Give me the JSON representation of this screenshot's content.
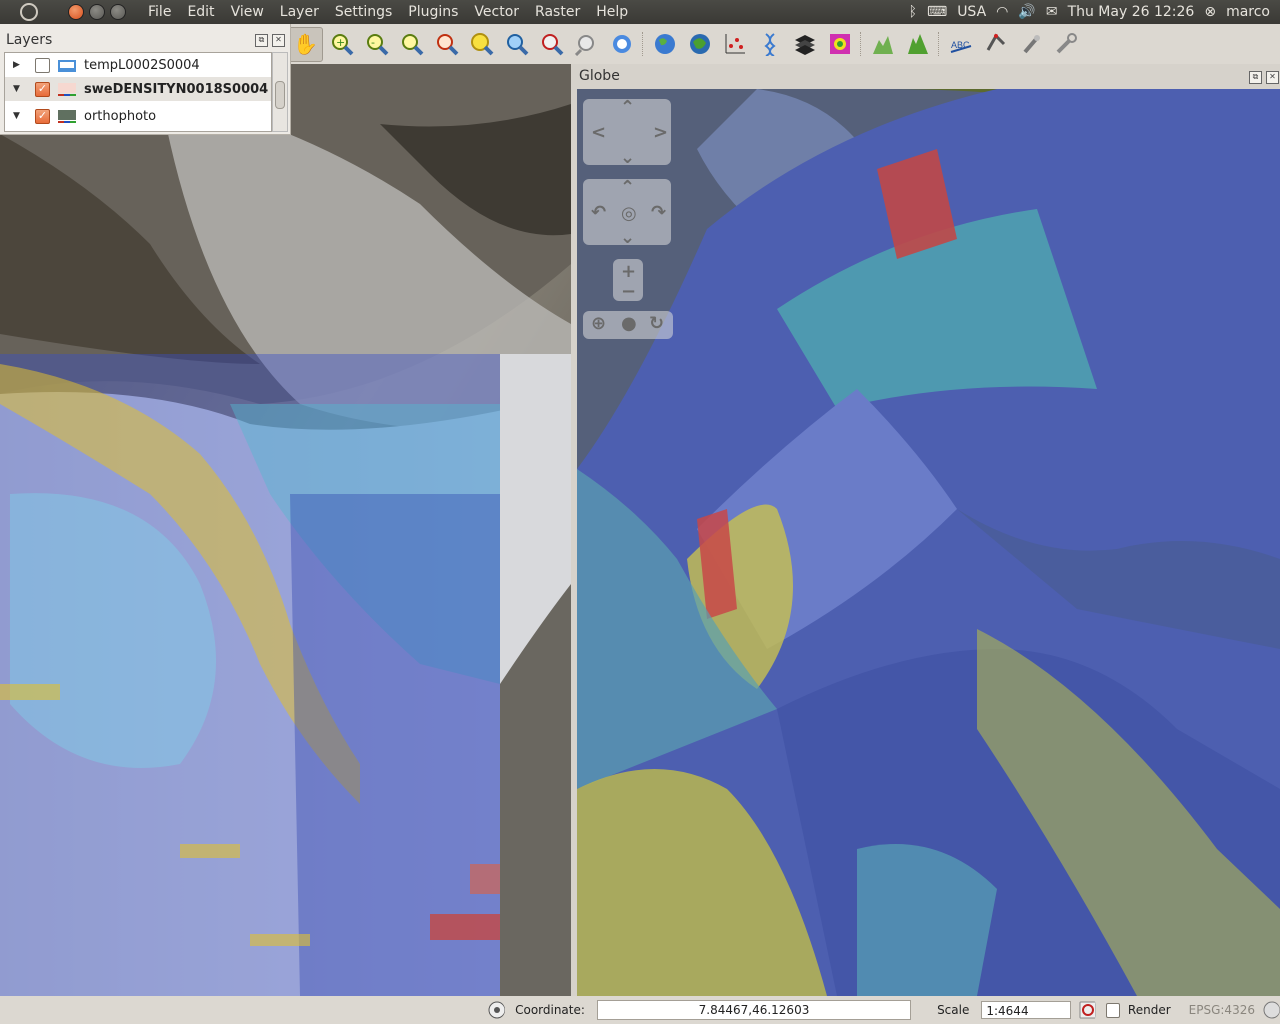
{
  "top_panel": {
    "menu": [
      "File",
      "Edit",
      "View",
      "Layer",
      "Settings",
      "Plugins",
      "Vector",
      "Raster",
      "Help"
    ],
    "keyboard": "USA",
    "clock": "Thu May 26 12:26",
    "user": "marco"
  },
  "layers_panel": {
    "title": "Layers",
    "layers": [
      {
        "name": "tempL0002S0004",
        "checked": false,
        "expanded": false,
        "selected": false
      },
      {
        "name": "sweDENSITYN0018S0004",
        "checked": true,
        "expanded": true,
        "selected": true
      },
      {
        "name": "orthophoto",
        "checked": true,
        "expanded": true,
        "selected": false
      }
    ]
  },
  "toolbar": {
    "tools": [
      "pan-icon",
      "zoom-in-icon",
      "zoom-out-icon",
      "zoom-full-icon",
      "zoom-selection-icon",
      "zoom-layer-icon",
      "zoom-native-icon",
      "zoom-last-icon",
      "zoom-next-icon",
      "refresh-icon",
      "globe-icon",
      "globe-3d-icon",
      "point-plot-icon",
      "dna-icon",
      "layers-stack-icon",
      "flower-icon",
      "terrain-icon",
      "histogram-icon",
      "label-abc-icon",
      "node-tool-icon",
      "pin-icon",
      "wrench-icon"
    ]
  },
  "globe": {
    "title": "Globe"
  },
  "statusbar": {
    "coordinate_label": "Coordinate:",
    "coordinate_value": "7.84467,46.12603",
    "scale_label": "Scale",
    "scale_value": "1:4644",
    "render_label": "Render",
    "crs": "EPSG:4326"
  }
}
